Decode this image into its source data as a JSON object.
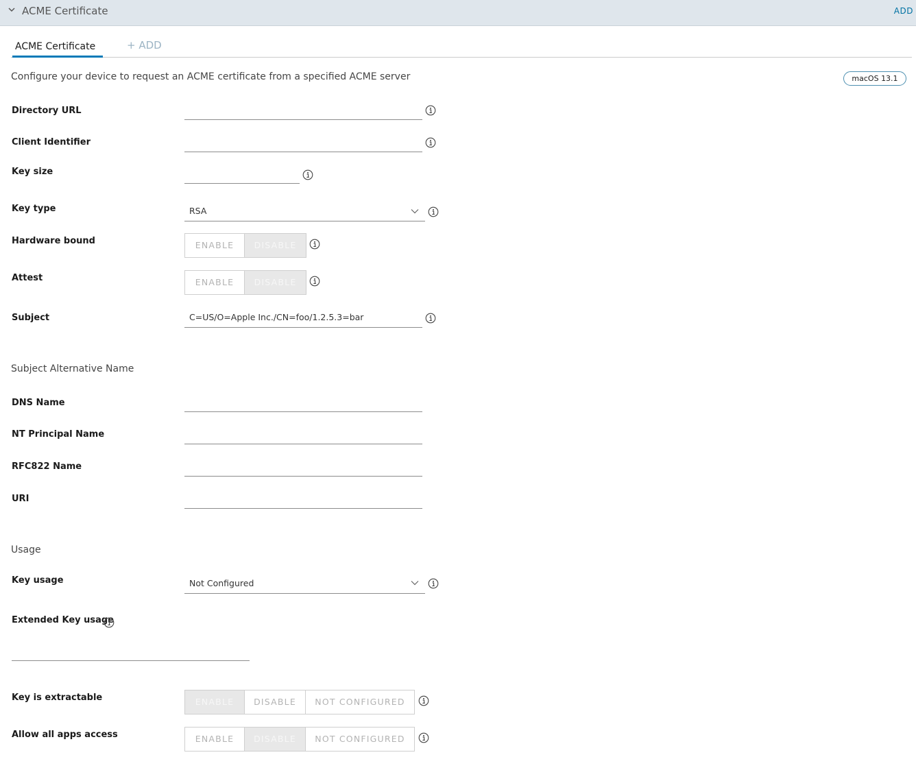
{
  "header": {
    "title": "ACME Certificate",
    "add_label": "ADD"
  },
  "tabs": {
    "active": "ACME Certificate",
    "add": "+ ADD"
  },
  "description": "Configure your device to request an ACME certificate from a specified ACME server",
  "os_badge": "macOS 13.1",
  "fields": {
    "directory_url": {
      "label": "Directory URL",
      "value": ""
    },
    "client_identifier": {
      "label": "Client Identifier",
      "value": ""
    },
    "key_size": {
      "label": "Key size",
      "value": ""
    },
    "key_type": {
      "label": "Key type",
      "value": "RSA"
    },
    "hardware_bound": {
      "label": "Hardware bound",
      "options": [
        "ENABLE",
        "DISABLE"
      ],
      "selected": "DISABLE"
    },
    "attest": {
      "label": "Attest",
      "options": [
        "ENABLE",
        "DISABLE"
      ],
      "selected": "DISABLE"
    },
    "subject": {
      "label": "Subject",
      "value": "C=US/O=Apple Inc./CN=foo/1.2.5.3=bar"
    }
  },
  "san": {
    "title": "Subject Alternative Name",
    "dns_name": {
      "label": "DNS Name",
      "value": ""
    },
    "nt_principal_name": {
      "label": "NT Principal Name",
      "value": ""
    },
    "rfc822_name": {
      "label": "RFC822 Name",
      "value": ""
    },
    "uri": {
      "label": "URI",
      "value": ""
    }
  },
  "usage": {
    "title": "Usage",
    "key_usage": {
      "label": "Key usage",
      "value": "Not Configured"
    },
    "extended_key_usage": {
      "label": "Extended Key usage",
      "value": ""
    },
    "key_is_extractable": {
      "label": "Key is extractable",
      "options": [
        "ENABLE",
        "DISABLE",
        "NOT CONFIGURED"
      ],
      "selected": "ENABLE"
    },
    "allow_all_apps_access": {
      "label": "Allow all apps access",
      "options": [
        "ENABLE",
        "DISABLE",
        "NOT CONFIGURED"
      ],
      "selected": "DISABLE"
    }
  },
  "icons": [
    "chevron-down-icon",
    "info-icon"
  ],
  "colors": {
    "accent": "#0079b8",
    "link": "#0072a3",
    "header_bg": "#dfe6ec",
    "selected_segment": "#e8e8e8"
  }
}
